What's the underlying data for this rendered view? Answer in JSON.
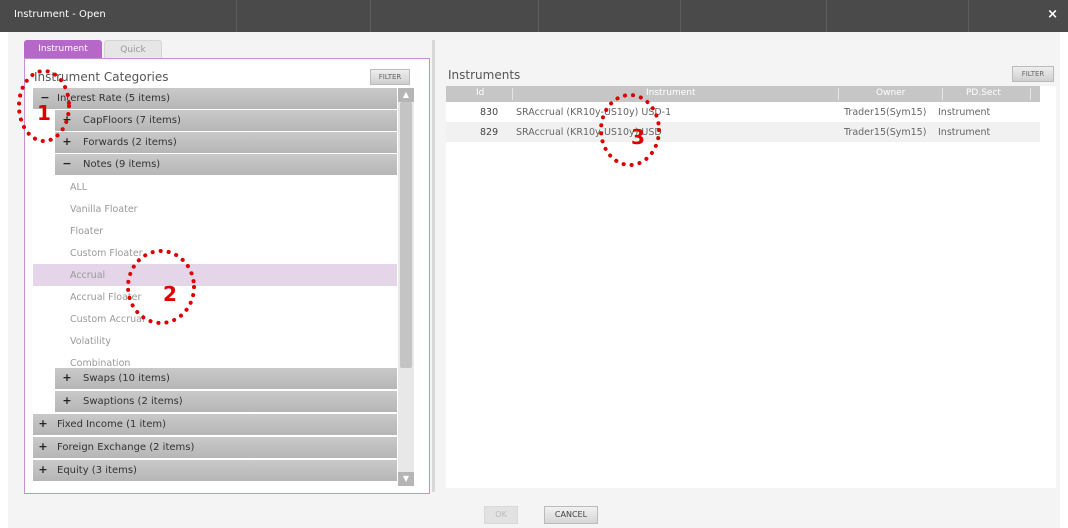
{
  "window": {
    "title": "Instrument - Open",
    "close_glyph": "×"
  },
  "tabs": [
    {
      "label": "Instrument",
      "active": true
    },
    {
      "label": "Quick",
      "active": false
    }
  ],
  "categories": {
    "title": "Instrument Categories",
    "filter_label": "FILTER",
    "items": [
      {
        "label": "Interest Rate (5 items)",
        "level": 0,
        "kind": "header",
        "toggle": "−"
      },
      {
        "label": "CapFloors (7 items)",
        "level": 1,
        "kind": "header",
        "toggle": "+"
      },
      {
        "label": "Forwards (2 items)",
        "level": 1,
        "kind": "header",
        "toggle": "+"
      },
      {
        "label": "Notes (9 items)",
        "level": 1,
        "kind": "header",
        "toggle": "−"
      },
      {
        "label": "ALL",
        "level": 2,
        "kind": "leaf"
      },
      {
        "label": "Vanilla Floater",
        "level": 2,
        "kind": "leaf"
      },
      {
        "label": "Floater",
        "level": 2,
        "kind": "leaf"
      },
      {
        "label": "Custom Floater",
        "level": 2,
        "kind": "leaf"
      },
      {
        "label": "Accrual",
        "level": 2,
        "kind": "leaf",
        "selected": true
      },
      {
        "label": "Accrual Floater",
        "level": 2,
        "kind": "leaf"
      },
      {
        "label": "Custom Accrual",
        "level": 2,
        "kind": "leaf"
      },
      {
        "label": "Volatility",
        "level": 2,
        "kind": "leaf"
      },
      {
        "label": "Combination",
        "level": 2,
        "kind": "leaf"
      },
      {
        "label": "Swaps (10 items)",
        "level": 1,
        "kind": "header",
        "toggle": "+"
      },
      {
        "label": "Swaptions (2 items)",
        "level": 1,
        "kind": "header",
        "toggle": "+"
      },
      {
        "label": "Fixed Income (1 item)",
        "level": 0,
        "kind": "header",
        "toggle": "+"
      },
      {
        "label": "Foreign Exchange (2 items)",
        "level": 0,
        "kind": "header",
        "toggle": "+"
      },
      {
        "label": "Equity (3 items)",
        "level": 0,
        "kind": "header",
        "toggle": "+"
      }
    ]
  },
  "instruments": {
    "title": "Instruments",
    "filter_label": "FILTER",
    "columns": [
      "Id",
      "Instrument",
      "Owner",
      "PD.Sect"
    ],
    "rows": [
      {
        "id": "830",
        "instrument": "SRAccrual (KR10y-US10y) USD-1",
        "owner": "Trader15(Sym15)",
        "pdsect": "Instrument"
      },
      {
        "id": "829",
        "instrument": "SRAccrual (KR10y-US10y) USD",
        "owner": "Trader15(Sym15)",
        "pdsect": "Instrument"
      }
    ]
  },
  "buttons": {
    "ok": "OK",
    "cancel": "CANCEL"
  },
  "callouts": [
    {
      "label": "1",
      "color": "#dd0000"
    },
    {
      "label": "2",
      "color": "#dd0000"
    },
    {
      "label": "3",
      "color": "#dd0000"
    }
  ]
}
